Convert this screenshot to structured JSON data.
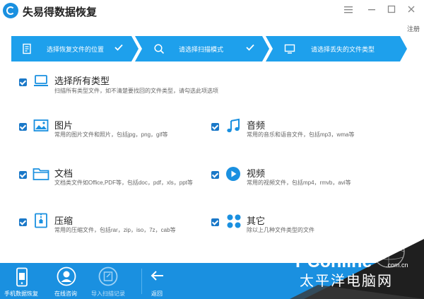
{
  "window": {
    "title": "失易得数据恢复",
    "menu_icon": "menu-icon",
    "min_icon": "minimize-icon",
    "max_icon": "maximize-icon",
    "close_icon": "close-icon",
    "register": "注册"
  },
  "steps": [
    {
      "label": "选择恢复文件的位置",
      "icon": "document-icon",
      "done": true
    },
    {
      "label": "请选择扫描模式",
      "icon": "search-icon",
      "done": true
    },
    {
      "label": "请选择丢失的文件类型",
      "icon": "monitor-icon",
      "done": false
    }
  ],
  "options": {
    "all": {
      "title": "选择所有类型",
      "desc": "扫描所有类型文件，如不清楚要找回的文件类型，请勾选此项选项",
      "checked": true,
      "icon": "laptop-icon"
    },
    "picture": {
      "title": "图片",
      "desc": "常用的图片文件和照片，包括jpg，png，gif等",
      "checked": true,
      "icon": "image-icon"
    },
    "audio": {
      "title": "音频",
      "desc": "常用的音乐和语音文件，包括mp3，wma等",
      "checked": true,
      "icon": "music-icon"
    },
    "document": {
      "title": "文档",
      "desc": "文档类文件如Office,PDF等，包括doc，pdf，xls，ppt等",
      "checked": true,
      "icon": "folder-icon"
    },
    "video": {
      "title": "视频",
      "desc": "常用的视频文件，包括mp4，rmvb，avi等",
      "checked": true,
      "icon": "play-icon"
    },
    "archive": {
      "title": "压缩",
      "desc": "常用的压缩文件，包括rar，zip，iso，7z，cab等",
      "checked": true,
      "icon": "archive-icon"
    },
    "other": {
      "title": "其它",
      "desc": "除以上几种文件类型的文件",
      "checked": true,
      "icon": "grid-icon"
    }
  },
  "bottom": {
    "phone_recovery": "手机数据恢复",
    "online_consult": "在线咨询",
    "import_scan": "导入扫描记录",
    "back": "返回"
  },
  "watermark": {
    "brand": "PConline",
    "domain": ".com.cn",
    "cn": "太平洋电脑网"
  },
  "colors": {
    "accent": "#1ea0ec",
    "bottom_bar": "#1a90e0",
    "checkbox": "#1a78c8"
  }
}
